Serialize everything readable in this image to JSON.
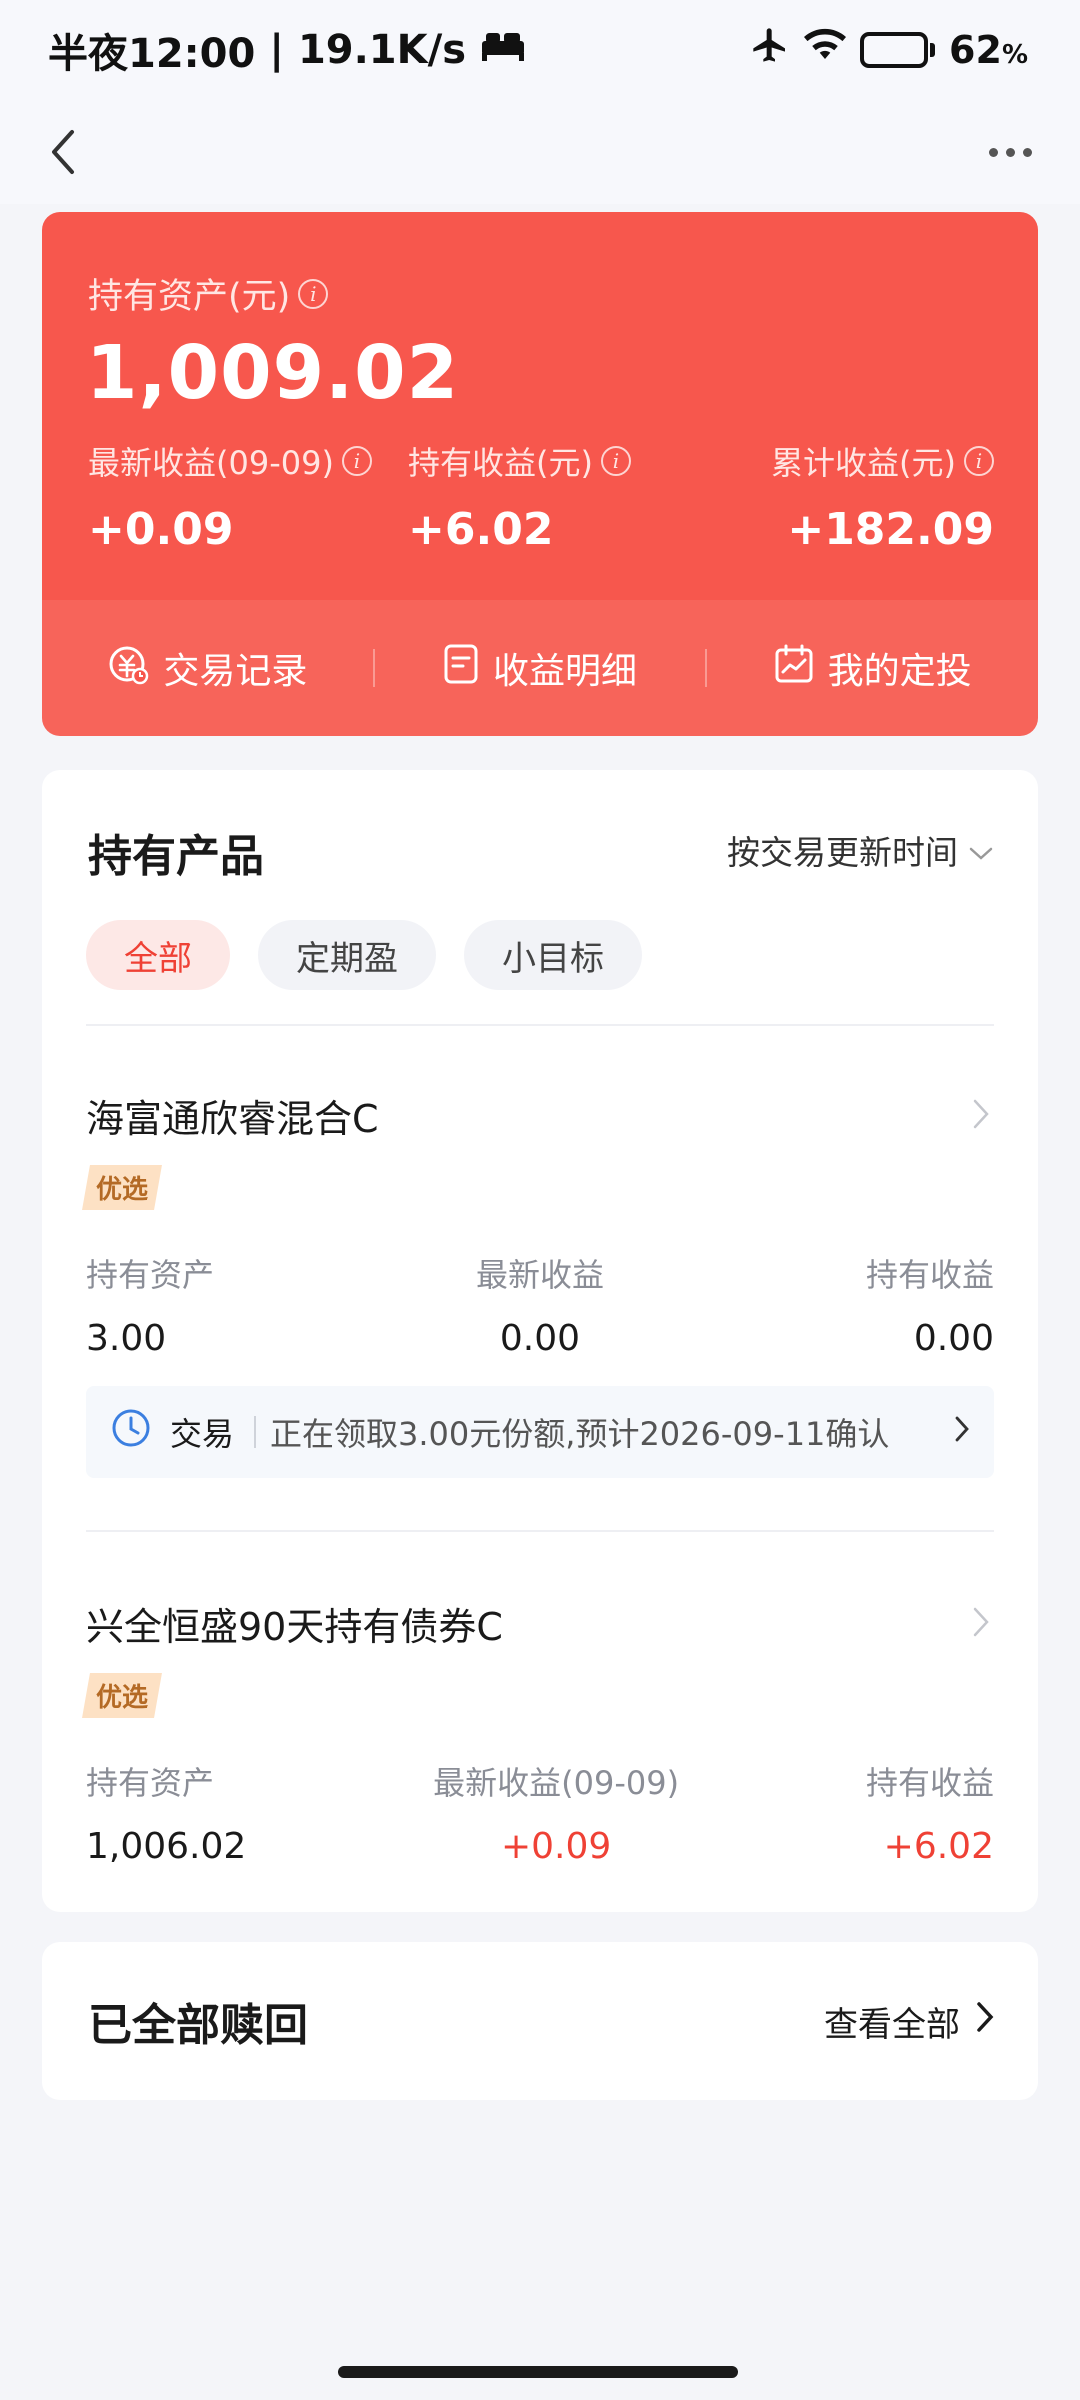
{
  "status_bar": {
    "time": "半夜12:00",
    "speed": "19.1K/s",
    "battery_pct": "62",
    "battery_unit": "%"
  },
  "asset_card": {
    "title": "持有资产(元)",
    "value": "1,009.02",
    "metrics": [
      {
        "label": "最新收益(09-09)",
        "value": "+0.09"
      },
      {
        "label": "持有收益(元)",
        "value": "+6.02"
      },
      {
        "label": "累计收益(元)",
        "value": "+182.09"
      }
    ],
    "actions": [
      {
        "label": "交易记录",
        "icon": "yuan-clock-icon"
      },
      {
        "label": "收益明细",
        "icon": "document-icon"
      },
      {
        "label": "我的定投",
        "icon": "calendar-chart-icon"
      }
    ],
    "colors": {
      "background": "#f7574d"
    }
  },
  "products": {
    "title": "持有产品",
    "sort_label": "按交易更新时间",
    "chips": [
      "全部",
      "定期盈",
      "小目标"
    ],
    "items": [
      {
        "name": "海富通欣睿混合C",
        "tag": "优选",
        "columns": [
          {
            "label": "持有资产",
            "value": "3.00"
          },
          {
            "label": "最新收益",
            "value": "0.00"
          },
          {
            "label": "持有收益",
            "value": "0.00"
          }
        ],
        "transaction": {
          "label": "交易",
          "text": "正在领取3.00元份额,预计2026-09-11确认"
        }
      },
      {
        "name": "兴全恒盛90天持有债券C",
        "tag": "优选",
        "columns": [
          {
            "label": "持有资产",
            "value": "1,006.02"
          },
          {
            "label": "最新收益(09-09)",
            "value": "+0.09"
          },
          {
            "label": "持有收益",
            "value": "+6.02"
          }
        ]
      }
    ]
  },
  "redeemed": {
    "title": "已全部赎回",
    "view_all": "查看全部"
  },
  "colors": {
    "accent_red": "#ef4135",
    "tag_bg": "#fde1c4",
    "tag_text": "#b46a25"
  }
}
